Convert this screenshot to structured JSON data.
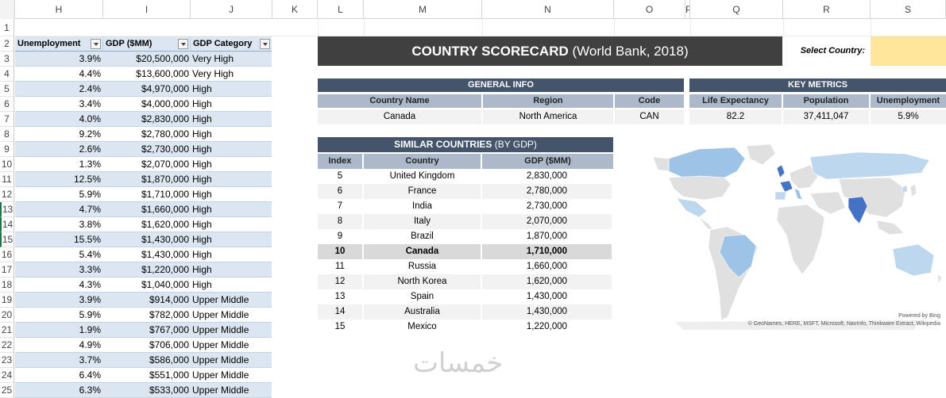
{
  "column_headers": [
    "H",
    "I",
    "J",
    "K",
    "L",
    "M",
    "N",
    "O",
    "P",
    "Q",
    "R",
    "S"
  ],
  "row_numbers": [
    "1",
    "2",
    "3",
    "4",
    "5",
    "6",
    "7",
    "8",
    "9",
    "10",
    "11",
    "12",
    "13",
    "14",
    "15",
    "16",
    "17",
    "18",
    "19",
    "20",
    "21",
    "22",
    "23",
    "24",
    "25"
  ],
  "data_table": {
    "headers": [
      "Unemployment",
      "GDP ($MM)",
      "GDP Category"
    ],
    "rows": [
      [
        "3.9%",
        "$20,500,000",
        "Very High"
      ],
      [
        "4.4%",
        "$13,600,000",
        "Very High"
      ],
      [
        "2.4%",
        "$4,970,000",
        "High"
      ],
      [
        "3.4%",
        "$4,000,000",
        "High"
      ],
      [
        "4.0%",
        "$2,830,000",
        "High"
      ],
      [
        "9.2%",
        "$2,780,000",
        "High"
      ],
      [
        "2.6%",
        "$2,730,000",
        "High"
      ],
      [
        "1.3%",
        "$2,070,000",
        "High"
      ],
      [
        "12.5%",
        "$1,870,000",
        "High"
      ],
      [
        "5.9%",
        "$1,710,000",
        "High"
      ],
      [
        "4.7%",
        "$1,660,000",
        "High"
      ],
      [
        "3.8%",
        "$1,620,000",
        "High"
      ],
      [
        "15.5%",
        "$1,430,000",
        "High"
      ],
      [
        "5.4%",
        "$1,430,000",
        "High"
      ],
      [
        "3.3%",
        "$1,220,000",
        "High"
      ],
      [
        "4.3%",
        "$1,040,000",
        "High"
      ],
      [
        "3.9%",
        "$914,000",
        "Upper Middle"
      ],
      [
        "5.9%",
        "$782,000",
        "Upper Middle"
      ],
      [
        "1.9%",
        "$767,000",
        "Upper Middle"
      ],
      [
        "4.9%",
        "$706,000",
        "Upper Middle"
      ],
      [
        "3.7%",
        "$586,000",
        "Upper Middle"
      ],
      [
        "6.4%",
        "$551,000",
        "Upper Middle"
      ],
      [
        "6.3%",
        "$533,000",
        "Upper Middle"
      ]
    ]
  },
  "scorecard": {
    "title_main": "COUNTRY SCORECARD",
    "title_sub": "(World Bank, 2018)",
    "select_label": "Select Country:",
    "select_value": "",
    "general_info": {
      "section": "GENERAL INFO",
      "headers": [
        "Country Name",
        "Region",
        "Code"
      ],
      "values": [
        "Canada",
        "North America",
        "CAN"
      ]
    },
    "key_metrics": {
      "section": "KEY METRICS",
      "headers": [
        "Life Expectancy",
        "Population",
        "Unemployment"
      ],
      "values": [
        "82.2",
        "37,411,047",
        "5.9%"
      ]
    },
    "similar": {
      "section_main": "SIMILAR COUNTRIES",
      "section_sub": "(BY GDP)",
      "headers": [
        "Index",
        "Country",
        "GDP ($MM)"
      ],
      "rows": [
        [
          "5",
          "United Kingdom",
          "2,830,000"
        ],
        [
          "6",
          "France",
          "2,780,000"
        ],
        [
          "7",
          "India",
          "2,730,000"
        ],
        [
          "8",
          "Italy",
          "2,070,000"
        ],
        [
          "9",
          "Brazil",
          "1,870,000"
        ],
        [
          "10",
          "Canada",
          "1,710,000"
        ],
        [
          "11",
          "Russia",
          "1,660,000"
        ],
        [
          "12",
          "North Korea",
          "1,620,000"
        ],
        [
          "13",
          "Spain",
          "1,430,000"
        ],
        [
          "14",
          "Australia",
          "1,430,000"
        ],
        [
          "15",
          "Mexico",
          "1,220,000"
        ]
      ],
      "highlight_index": 5
    }
  },
  "map": {
    "powered_by": "Powered by Bing",
    "attribution": "© GeoNames, HERE, MSFT, Microsoft, NavInfo, Thinkware Extract, Wikipedia"
  },
  "watermark": "خمسات",
  "colors": {
    "table_band": "#dce6f1",
    "title_bg": "#404040",
    "section_bg": "#44546a",
    "subheader_bg": "#acb9ca",
    "select_bg": "#ffe699",
    "map_land": "#e0e0e0",
    "map_light": "#bdd7ee",
    "map_mid": "#9dc3e6",
    "map_dark": "#4472c4"
  }
}
